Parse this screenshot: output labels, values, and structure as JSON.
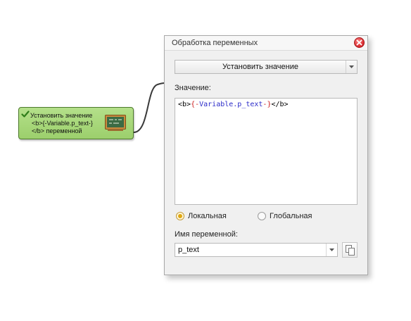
{
  "node": {
    "line1": "Установить значение",
    "line2": "<b>{-Variable.p_text-}",
    "line3": "</b> переменной",
    "icons": {
      "status": "checkmark-icon",
      "image": "chalkboard-icon"
    },
    "colors": {
      "fill": "#a8d87a",
      "border": "#4d7a2c"
    }
  },
  "dialog": {
    "title": "Обработка переменных",
    "action": {
      "selected": "Установить значение"
    },
    "value_label": "Значение:",
    "value_code": {
      "open_tag": "<b>",
      "brace_open": "{-",
      "variable": "Variable.p_text",
      "brace_close": "-}",
      "close_tag": "</b>"
    },
    "scope": {
      "local": "Локальная",
      "global": "Глобальная",
      "selected": "local"
    },
    "name_label": "Имя переменной:",
    "name_value": "p_text",
    "icons": {
      "close": "close-icon",
      "copy": "copy-icon",
      "dropdown": "chevron-down-icon"
    },
    "colors": {
      "close": "#d8262b",
      "radio_selected": "#e0a810"
    }
  }
}
